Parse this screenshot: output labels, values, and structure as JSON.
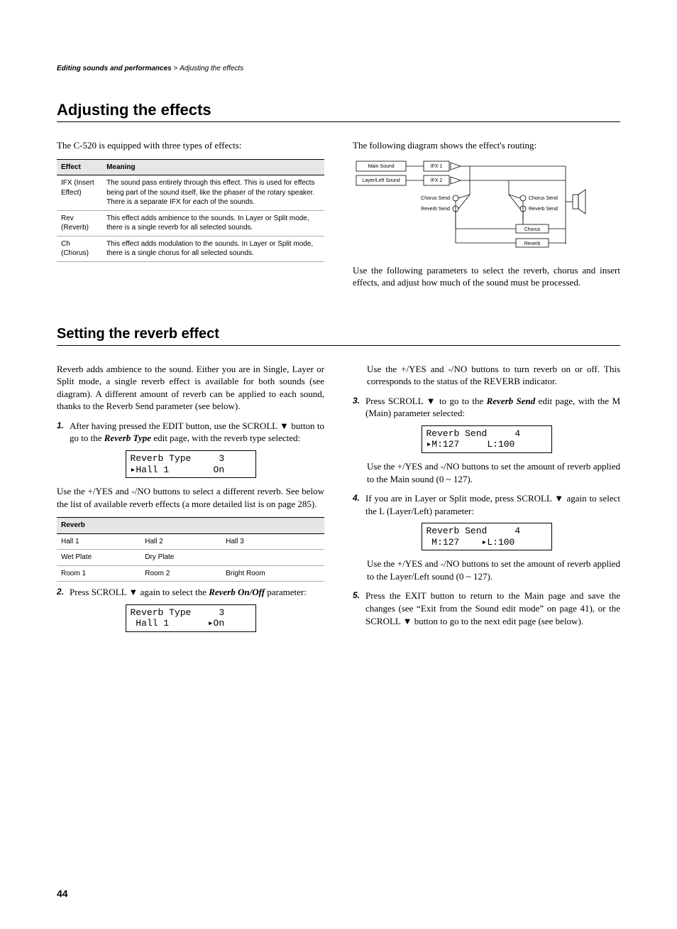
{
  "breadcrumb": {
    "section": "Editing sounds and performances",
    "sub": "Adjusting the effects"
  },
  "h1": "Adjusting the effects",
  "intro_left": "The C-520 is equipped with three types of effects:",
  "effects_table": {
    "headers": [
      "Effect",
      "Meaning"
    ],
    "rows": [
      [
        "IFX (Insert Effect)",
        "The sound pass entirely through this effect. This is used for effects being part of the sound itself, like the phaser of the rotary speaker. There is a separate IFX for each of the sounds."
      ],
      [
        "Rev (Reverb)",
        "This effect adds ambience to the sounds. In Layer or Split mode, there is a single reverb for all selected sounds."
      ],
      [
        "Ch (Chorus)",
        "This effect adds modulation to the sounds. In Layer or Split mode, there is a single chorus for all selected sounds."
      ]
    ]
  },
  "intro_right": "The following diagram shows the effect's routing:",
  "diagram": {
    "main_sound": "Main Sound",
    "layer_sound": "Layer/Left Sound",
    "ifx1": "IFX 1",
    "ifx2": "IFX 2",
    "chorus_send": "Chorus Send",
    "reverb_send": "Reverb Send",
    "chorus": "Chorus",
    "reverb": "Reverb"
  },
  "after_diagram": "Use the following parameters to select the reverb, chorus and insert effects, and adjust how much of the sound must be processed.",
  "h2": "Setting the reverb effect",
  "reverb_intro": "Reverb adds ambience to the sound. Either you are in Single, Layer or Split mode, a single reverb effect is available for both sounds (see diagram). A different amount of reverb can be applied to each sound, thanks to the Reverb Send parameter (see below).",
  "step1_a": "After having pressed the EDIT button, use the SCROLL ",
  "step1_b": " button to go to the ",
  "step1_c": "Reverb Type",
  "step1_d": " edit page, with the reverb type selected:",
  "lcd1": "Reverb Type     3\n▸Hall 1        On",
  "after_lcd1": "Use the +/YES and -/NO buttons to select a different reverb. See below the list of available reverb effects (a more detailed list is on page 285).",
  "reverb_table": {
    "header": "Reverb",
    "rows": [
      [
        "Hall 1",
        "Hall 2",
        "Hall 3"
      ],
      [
        "Wet Plate",
        "Dry Plate",
        ""
      ],
      [
        "Room 1",
        "Room 2",
        "Bright Room"
      ]
    ]
  },
  "step2_a": "Press SCROLL ",
  "step2_b": " again to select the ",
  "step2_c": "Reverb On/Off",
  "step2_d": " parameter:",
  "lcd2": "Reverb Type     3\n Hall 1       ▸On",
  "right_p1": "Use the +/YES and -/NO buttons to turn reverb on or off. This corresponds to the status of the REVERB indicator.",
  "step3_a": "Press SCROLL ",
  "step3_b": " to go to the ",
  "step3_c": "Reverb Send",
  "step3_d": " edit page, with the M (Main) parameter selected:",
  "lcd3": "Reverb Send     4\n▸M:127     L:100",
  "after_lcd3": "Use the +/YES and -/NO buttons to set the amount of reverb applied to the Main sound (0 ~ 127).",
  "step4_a": "If you are in Layer or Split mode, press SCROLL ",
  "step4_b": " again to select the L (Layer/Left) parameter:",
  "lcd4": "Reverb Send     4\n M:127    ▸L:100",
  "after_lcd4": "Use the +/YES and -/NO buttons to set the amount of reverb applied to the Layer/Left sound (0 ~ 127).",
  "step5_a": "Press the EXIT button to return to the Main page and save the changes (see “Exit from the Sound edit mode” on page 41), or the SCROLL ",
  "step5_b": " button to go to the next edit page (see below).",
  "page_number": "44"
}
